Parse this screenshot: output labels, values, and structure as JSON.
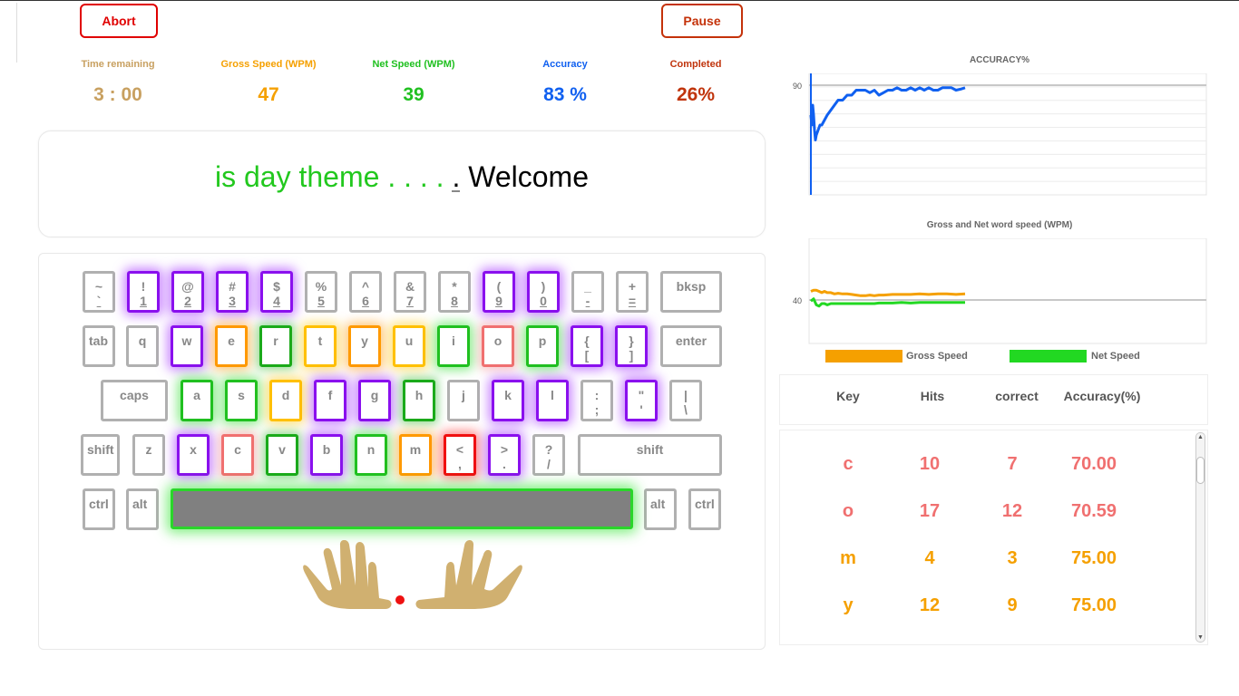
{
  "buttons": {
    "abort": "Abort",
    "pause": "Pause"
  },
  "stats": {
    "time": {
      "label": "Time remaining",
      "value": "3 : 00",
      "color": "#c8a060"
    },
    "gross": {
      "label": "Gross Speed (WPM)",
      "value": "47",
      "color": "#f5a000"
    },
    "net": {
      "label": "Net Speed (WPM)",
      "value": "39",
      "color": "#20c020"
    },
    "accuracy": {
      "label": "Accuracy",
      "value": "83 %",
      "color": "#1060f0"
    },
    "completed": {
      "label": "Completed",
      "value": "26%",
      "color": "#c0340c"
    }
  },
  "typing": {
    "done": "is day theme . . . . ",
    "current": ".",
    "rest": " Welcome"
  },
  "keyboard": {
    "row1": [
      {
        "t1": "~",
        "t2": "`",
        "c": ""
      },
      {
        "t1": "!",
        "t2": "1",
        "c": "purple"
      },
      {
        "t1": "@",
        "t2": "2",
        "c": "purple"
      },
      {
        "t1": "#",
        "t2": "3",
        "c": "purple"
      },
      {
        "t1": "$",
        "t2": "4",
        "c": "purple"
      },
      {
        "t1": "%",
        "t2": "5",
        "c": ""
      },
      {
        "t1": "^",
        "t2": "6",
        "c": ""
      },
      {
        "t1": "&",
        "t2": "7",
        "c": ""
      },
      {
        "t1": "*",
        "t2": "8",
        "c": ""
      },
      {
        "t1": "(",
        "t2": "9",
        "c": "purple"
      },
      {
        "t1": ")",
        "t2": "0",
        "c": "purple"
      },
      {
        "t1": "_",
        "t2": "-",
        "c": ""
      },
      {
        "t1": "+",
        "t2": "=",
        "c": ""
      }
    ],
    "row2": [
      {
        "t1": "q",
        "c": ""
      },
      {
        "t1": "w",
        "c": "purple"
      },
      {
        "t1": "e",
        "c": "orange"
      },
      {
        "t1": "r",
        "c": "dgreen"
      },
      {
        "t1": "t",
        "c": "yellow"
      },
      {
        "t1": "y",
        "c": "orange"
      },
      {
        "t1": "u",
        "c": "yellow"
      },
      {
        "t1": "i",
        "c": "green"
      },
      {
        "t1": "o",
        "c": "salmon"
      },
      {
        "t1": "p",
        "c": "green"
      },
      {
        "t1": "{",
        "t2": "[",
        "c": "purple"
      },
      {
        "t1": "}",
        "t2": "]",
        "c": "purple"
      }
    ],
    "row3": [
      {
        "t1": "a",
        "c": "green"
      },
      {
        "t1": "s",
        "c": "green"
      },
      {
        "t1": "d",
        "c": "yellow"
      },
      {
        "t1": "f",
        "c": "purple"
      },
      {
        "t1": "g",
        "c": "purple"
      },
      {
        "t1": "h",
        "c": "dgreen"
      },
      {
        "t1": "j",
        "c": ""
      },
      {
        "t1": "k",
        "c": "purple"
      },
      {
        "t1": "l",
        "c": "purple"
      },
      {
        "t1": ":",
        "t2": ";",
        "c": ""
      },
      {
        "t1": "\"",
        "t2": "'",
        "c": "purple"
      },
      {
        "t1": "|",
        "t2": "\\",
        "c": ""
      }
    ],
    "row4": [
      {
        "t1": "z",
        "c": ""
      },
      {
        "t1": "x",
        "c": "purple"
      },
      {
        "t1": "c",
        "c": "salmon"
      },
      {
        "t1": "v",
        "c": "dgreen"
      },
      {
        "t1": "b",
        "c": "purple"
      },
      {
        "t1": "n",
        "c": "green"
      },
      {
        "t1": "m",
        "c": "orange"
      },
      {
        "t1": "<",
        "t2": ",",
        "c": "red"
      },
      {
        "t1": ">",
        "t2": ".",
        "c": "purple"
      },
      {
        "t1": "?",
        "t2": "/",
        "c": ""
      }
    ],
    "mods": {
      "bksp": "bksp",
      "tab": "tab",
      "enter": "enter",
      "caps": "caps",
      "shift": "shift",
      "ctrl": "ctrl",
      "alt": "alt"
    }
  },
  "chart_data": [
    {
      "type": "line",
      "title": "ACCURACY%",
      "yticks": [
        "90"
      ],
      "series": [
        {
          "color": "#1060f0",
          "x": [
            0,
            1,
            2,
            3,
            4,
            5,
            6,
            8,
            10,
            12,
            15,
            18,
            22,
            26,
            30,
            35,
            40,
            45,
            50,
            55,
            60,
            65,
            70,
            75,
            80,
            85,
            90,
            95,
            100,
            105,
            110,
            115,
            120,
            125,
            130,
            135,
            140,
            145,
            150,
            155,
            160,
            165,
            170
          ],
          "values": [
            84,
            82,
            86,
            84,
            81,
            79,
            80,
            81,
            82,
            82,
            83,
            84,
            85,
            86,
            87,
            87,
            88,
            88,
            89,
            89,
            89,
            88.5,
            89,
            88,
            88.5,
            89,
            89,
            89.5,
            89,
            89,
            89.5,
            89,
            89.5,
            89,
            89.5,
            89,
            89,
            89.5,
            89.5,
            89.5,
            89,
            89.2,
            89.5
          ]
        }
      ]
    },
    {
      "type": "line",
      "title": "Gross and Net word speed (WPM)",
      "yticks": [
        "40"
      ],
      "legend": [
        "Gross Speed",
        "Net Speed"
      ],
      "series": [
        {
          "name": "Gross Speed",
          "color": "#f5a000",
          "x": [
            0,
            3,
            6,
            9,
            12,
            15,
            18,
            22,
            26,
            30,
            35,
            40,
            45,
            50,
            55,
            60,
            65,
            70,
            75,
            80,
            90,
            100,
            110,
            120,
            130,
            140,
            150,
            160,
            170
          ],
          "values": [
            47,
            48,
            48,
            47,
            46,
            47,
            46,
            46,
            45,
            45.5,
            45,
            45,
            44.5,
            44,
            43.5,
            43.5,
            44,
            43.5,
            44,
            44,
            44.5,
            44.5,
            44.5,
            45,
            44.5,
            45,
            45,
            44.5,
            45
          ]
        },
        {
          "name": "Net Speed",
          "color": "#22d822",
          "x": [
            0,
            3,
            6,
            9,
            12,
            15,
            18,
            22,
            26,
            30,
            35,
            40,
            45,
            50,
            55,
            60,
            65,
            70,
            75,
            80,
            90,
            100,
            110,
            120,
            130,
            140,
            150,
            160,
            170
          ],
          "values": [
            39,
            41,
            36,
            35,
            37,
            37,
            36,
            37,
            37,
            37,
            37,
            37,
            37,
            37,
            37,
            37,
            37,
            37,
            37.5,
            37.5,
            37.5,
            38,
            37.5,
            38,
            38,
            38,
            38,
            38,
            38
          ]
        }
      ]
    }
  ],
  "table": {
    "headers": [
      "Key",
      "Hits",
      "correct",
      "Accuracy(%)"
    ],
    "rows": [
      {
        "key": "c",
        "hits": "10",
        "correct": "7",
        "acc": "70.00",
        "color": "#f07070"
      },
      {
        "key": "o",
        "hits": "17",
        "correct": "12",
        "acc": "70.59",
        "color": "#f07070"
      },
      {
        "key": "m",
        "hits": "4",
        "correct": "3",
        "acc": "75.00",
        "color": "#f5a000"
      },
      {
        "key": "y",
        "hits": "12",
        "correct": "9",
        "acc": "75.00",
        "color": "#f5a000"
      }
    ]
  }
}
